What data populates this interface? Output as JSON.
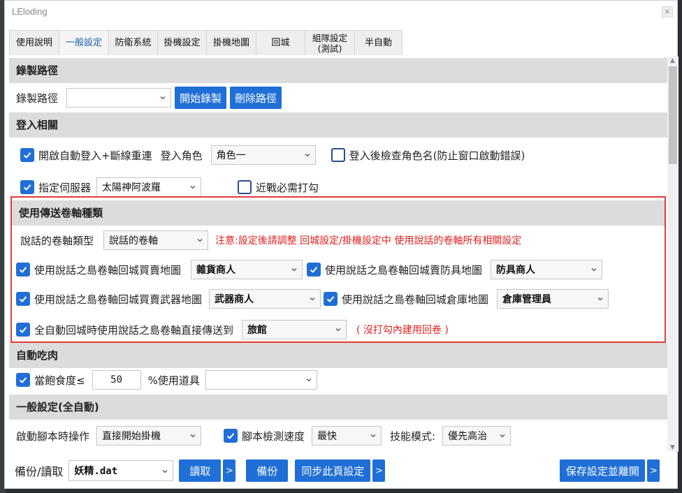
{
  "window": {
    "title": "LEloding"
  },
  "tabs": [
    {
      "label": "使用說明"
    },
    {
      "label": "一般設定"
    },
    {
      "label": "防衛系統"
    },
    {
      "label": "掛機設定"
    },
    {
      "label": "掛機地圖"
    },
    {
      "label": "回城"
    },
    {
      "label": "組隊設定\n(測試)"
    },
    {
      "label": "半自動"
    }
  ],
  "record": {
    "header": "錄製路徑",
    "label": "錄製路徑",
    "select_value": "",
    "start_button": "開始錄製",
    "delete_button": "刪除路徑"
  },
  "login": {
    "header": "登入相關",
    "auto_login_label": "開啟自動登入+斷線重連",
    "auto_login_checked": true,
    "role_label": "登入角色",
    "role_value": "角色一",
    "check_name_label": "登入後檢查角色名(防止窗口啟動錯誤)",
    "check_name_checked": false,
    "server_label": "指定伺服器",
    "server_checked": true,
    "server_value": "太陽神阿波羅",
    "melee_label": "近戰必需打勾",
    "melee_checked": false
  },
  "scroll": {
    "header": "使用傳送卷軸種類",
    "type_label": "說話的卷軸類型",
    "type_value": "說話的卷軸",
    "notice": "注意:設定後請調整 回城設定/掛機設定中 使用說話的卷軸所有相關設定",
    "sell_misc_label": "使用說話之島卷軸回城買賣地圖",
    "sell_misc_value": "雜貨商人",
    "sell_armor_label": "使用說話之島卷軸回城賣防具地圖",
    "sell_armor_value": "防具商人",
    "sell_weapon_label": "使用說話之島卷軸回城買賣武器地圖",
    "sell_weapon_value": "武器商人",
    "warehouse_label": "使用說話之島卷軸回城倉庫地圖",
    "warehouse_value": "倉庫管理員",
    "auto_teleport_label": "全自動回城時使用說話之島卷軸直接傳送到",
    "auto_teleport_value": "旅館",
    "auto_teleport_note": "( 沒打勾內建用回卷 )"
  },
  "eat": {
    "header": "自動吃肉",
    "full_label": "當飽食度≤",
    "full_checked": true,
    "full_value": "50",
    "use_item_label": "%使用道具",
    "item_value": ""
  },
  "general": {
    "header": "一般設定(全自動)",
    "start_action_label": "啟動腳本時操作",
    "start_action_value": "直接開始掛機",
    "speed_label": "腳本檢測速度",
    "speed_checked": true,
    "speed_value": "最快",
    "skill_label": "技能模式:",
    "skill_value": "優先高治"
  },
  "footer": {
    "backup_label": "備份/讀取",
    "file_value": "妖精.dat",
    "read_button": "讀取",
    "backup_button": "備份",
    "sync_button": "同步此頁設定",
    "save_button": "保存設定並離開",
    "more_glyph": ">"
  },
  "colors": {
    "accent": "#1f6fd6",
    "warning": "#e02020",
    "highlight_border": "#e03a3a"
  }
}
